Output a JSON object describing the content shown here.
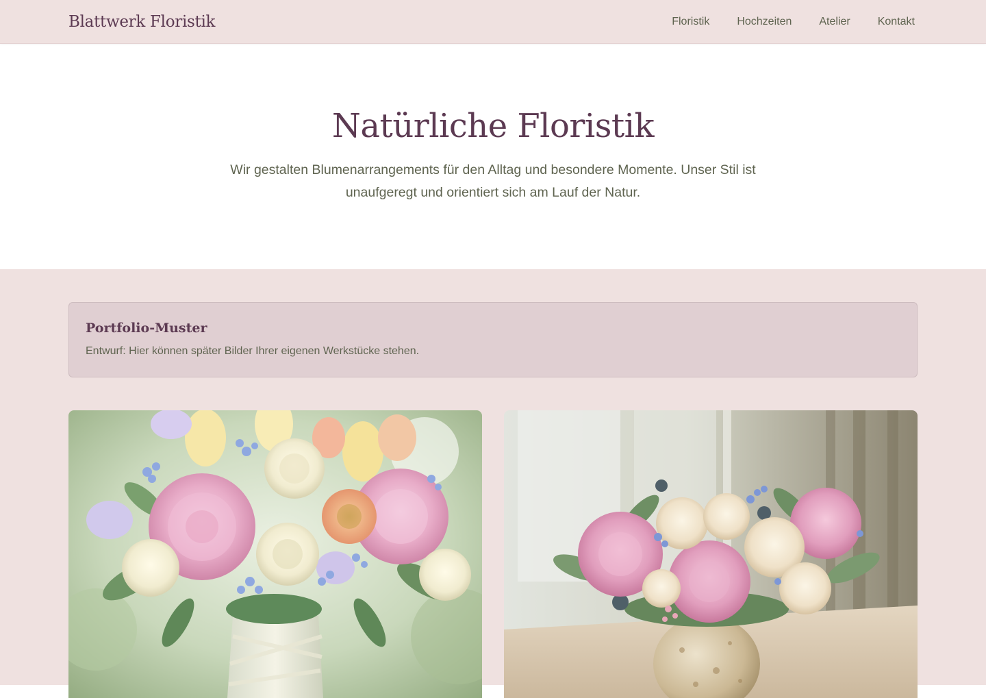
{
  "header": {
    "brand": "Blattwerk Floristik",
    "nav": [
      "Floristik",
      "Hochzeiten",
      "Atelier",
      "Kontakt"
    ]
  },
  "hero": {
    "title": "Natürliche Floristik",
    "text": "Wir gestalten Blumenarrangements für den Alltag und besondere Momente. Unser Stil ist unaufgeregt und orientiert sich am Lauf der Natur."
  },
  "notice": {
    "title": "Portfolio-Muster",
    "text": "Entwurf: Hier können später Bilder Ihrer eigenen Werkstücke stehen."
  },
  "colors": {
    "header_bg": "#efe1e0",
    "accent_plum": "#5c3a52",
    "text_olive": "#5f6450",
    "notice_bg": "#e0cfd2"
  }
}
